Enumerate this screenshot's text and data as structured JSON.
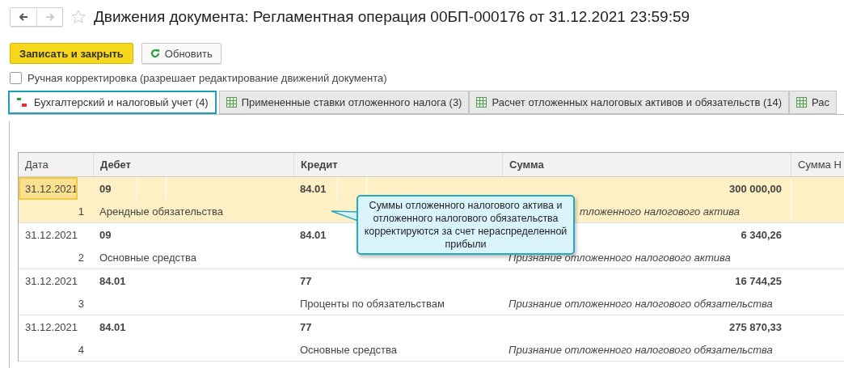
{
  "window": {
    "title": "Движения документа: Регламентная операция 00БП-000176 от 31.12.2021 23:59:59",
    "favorite": false
  },
  "toolbar": {
    "primary": "Записать и закрыть",
    "refresh": "Обновить"
  },
  "manual_edit": {
    "label": "Ручная корректировка (разрешает редактирование движений документа)",
    "checked": false
  },
  "tabs": [
    {
      "label": "Бухгалтерский и налоговый учет (4)",
      "kind": "accounting",
      "selected": true
    },
    {
      "label": "Примененные ставки отложенного налога (3)",
      "kind": "table",
      "selected": false
    },
    {
      "label": "Расчет отложенных налоговых активов и обязательств (14)",
      "kind": "table",
      "selected": false
    },
    {
      "label": "Рас",
      "kind": "table",
      "selected": false
    }
  ],
  "table": {
    "columns": [
      "Дата",
      "Дебет",
      "Кредит",
      "Сумма",
      "Сумма Н"
    ],
    "rows": [
      {
        "date": "31.12.2021",
        "number": "1",
        "debit": {
          "account": "09",
          "subconto": "Арендные обязательства"
        },
        "credit": {
          "account": "84.01"
        },
        "sum": "300 000,00",
        "description": "тложенного налогового актива",
        "description_covered": true,
        "selected": true
      },
      {
        "date": "31.12.2021",
        "number": "2",
        "debit": {
          "account": "09",
          "subconto": "Основные средства"
        },
        "credit": {
          "account": "84.01"
        },
        "sum": "6 340,26",
        "description": "Признание отложенного налогового актива",
        "description_covered": false,
        "selected": false
      },
      {
        "date": "31.12.2021",
        "number": "3",
        "debit": {
          "account": "84.01"
        },
        "credit": {
          "account": "77",
          "subconto": "Проценты по обязательствам"
        },
        "sum": "16 744,25",
        "description": "Признание отложенного налогового обязательства",
        "description_covered": false,
        "selected": false
      },
      {
        "date": "31.12.2021",
        "number": "4",
        "debit": {
          "account": "84.01"
        },
        "credit": {
          "account": "77",
          "subconto": "Основные средства"
        },
        "sum": "275 870,33",
        "description": "Признание отложенного налогового обязательства",
        "description_covered": false,
        "selected": false
      }
    ]
  },
  "callout": {
    "text": "Суммы отложенного налогового актива и отложенного налогового обязательства корректируются за счет нераспределенной прибыли"
  }
}
